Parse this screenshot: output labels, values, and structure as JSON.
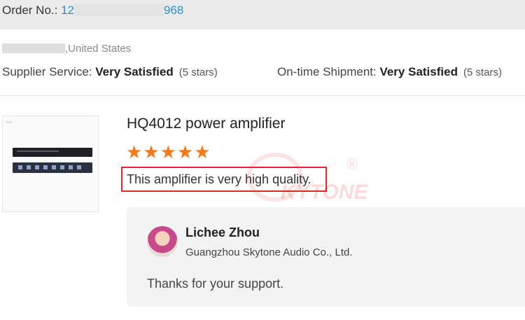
{
  "order": {
    "label": "Order No.: ",
    "prefix": "12",
    "suffix": "968"
  },
  "buyer": {
    "location": ",United States"
  },
  "ratings": {
    "supplier": {
      "label": "Supplier Service: ",
      "value": "Very Satisfied",
      "note": "(5 stars)"
    },
    "shipment": {
      "label": "On-time Shipment: ",
      "value": "Very Satisfied",
      "note": "(5 stars)"
    }
  },
  "product": {
    "title": "HQ4012 power amplifier",
    "stars": "★★★★★",
    "star_count": 5,
    "star_color": "#f07a1c",
    "review": "This amplifier is very high quality."
  },
  "reply": {
    "name": "Lichee Zhou",
    "company": "Guangzhou Skytone Audio Co., Ltd.",
    "message": "Thanks for your support."
  },
  "colors": {
    "order_number": "#2a8fd0",
    "highlight_box": "#e0262e",
    "header_bg": "#ebebeb",
    "reply_bg": "#f3f3f3"
  }
}
